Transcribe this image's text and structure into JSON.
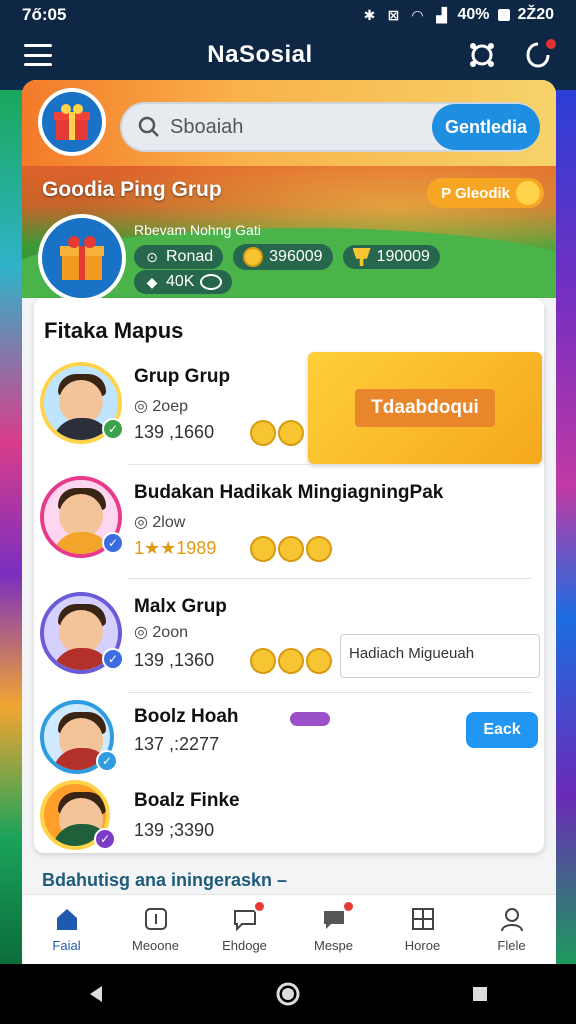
{
  "status_bar": {
    "time": "7ő:05",
    "battery": "40%",
    "clock_right": "2Ž20"
  },
  "app_bar": {
    "title": "NaSosial"
  },
  "search": {
    "placeholder": "Sboaiah",
    "button_label": "Gentledia"
  },
  "banner": {
    "title": "Goodia Ping Grup",
    "pill_label": "P Gleodik",
    "subtitle": "Rbevam Nohng Gati",
    "stat_a_label": "Ronad",
    "stat_b_value": "396009",
    "stat_c_value": "190009",
    "stat_d_label": "40K"
  },
  "list": {
    "title": "Fitaka Mapus",
    "cta_label": "Tdaabdoqui",
    "input_value": "Hadiach Migueuah",
    "back_button": "Eack",
    "rows": [
      {
        "name": "Grup Grup",
        "meta": "2oep",
        "count": "139 ,1660",
        "verify_color": "#3aa24a"
      },
      {
        "name": "Budakan Hadikak MingiagningPak",
        "meta": "2low",
        "count": "1★★1989",
        "verify_color": "#3b6de0"
      },
      {
        "name": "Malx Grup",
        "meta": "2oon",
        "count": "139 ,1360",
        "verify_color": "#3b6de0"
      },
      {
        "name": "Boolz Hoah",
        "meta": "",
        "count": "137 ,:2277",
        "verify_color": "#2f9be0"
      },
      {
        "name": "Boalz Finke",
        "meta": "",
        "count": "139 ;3390",
        "verify_color": "#7e3bc8"
      }
    ]
  },
  "footer_link": "Bdahutisg ana iningeraskn –",
  "bottom_nav": [
    {
      "label": "Faial",
      "icon": "home-icon"
    },
    {
      "label": "Meoone",
      "icon": "info-icon"
    },
    {
      "label": "Ehdoge",
      "icon": "chat-icon"
    },
    {
      "label": "Mespe",
      "icon": "message-icon"
    },
    {
      "label": "Horoe",
      "icon": "grid-icon"
    },
    {
      "label": "Flele",
      "icon": "profile-icon"
    }
  ]
}
